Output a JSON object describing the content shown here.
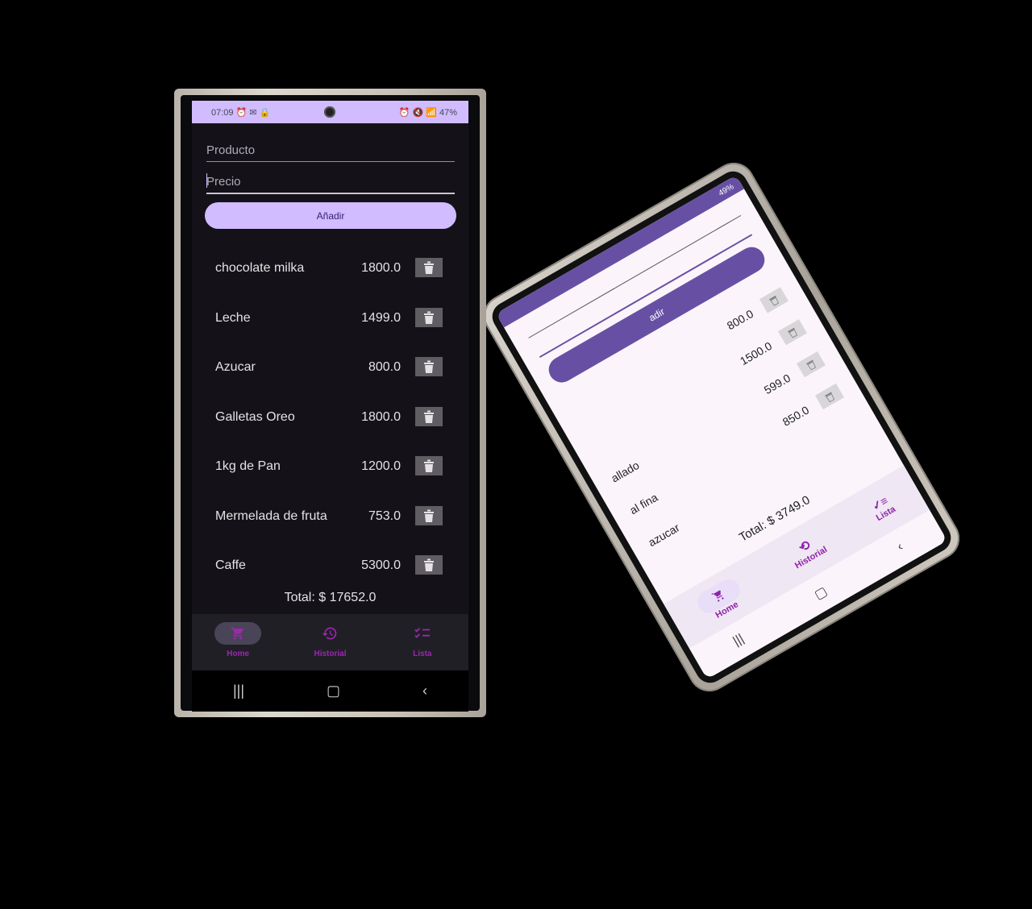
{
  "front_phone": {
    "status": {
      "time": "07:09",
      "battery": "47%"
    },
    "form": {
      "product_placeholder": "Producto",
      "price_placeholder": "Precio",
      "add_label": "Añadir"
    },
    "items": [
      {
        "name": "chocolate milka",
        "price": "1800.0"
      },
      {
        "name": "Leche",
        "price": "1499.0"
      },
      {
        "name": "Azucar",
        "price": "800.0"
      },
      {
        "name": "Galletas Oreo",
        "price": "1800.0"
      },
      {
        "name": "1kg de Pan",
        "price": "1200.0"
      },
      {
        "name": "Mermelada de fruta",
        "price": "753.0"
      },
      {
        "name": "Caffe",
        "price": "5300.0"
      }
    ],
    "total": "Total: $ 17652.0",
    "nav": {
      "home": "Home",
      "history": "Historial",
      "list": "Lista"
    },
    "icons": {
      "home": "cart-icon",
      "history": "history-icon",
      "list": "checklist-icon",
      "delete": "trash-icon"
    },
    "colors": {
      "accent": "#d0bcff",
      "nav_label": "#9c27b0",
      "background": "#141218"
    }
  },
  "back_phone": {
    "status": {
      "battery": "49%"
    },
    "add_label": "adir",
    "items": [
      {
        "name": "",
        "price": "800.0"
      },
      {
        "name": "",
        "price": "1500.0"
      },
      {
        "name": "allado",
        "price": "599.0"
      },
      {
        "name": "al fina",
        "price": "850.0"
      },
      {
        "name": "azucar",
        "price": ""
      }
    ],
    "total": "Total: $ 3749.0",
    "nav": {
      "home": "Home",
      "history": "Historial",
      "list": "Lista"
    },
    "colors": {
      "accent": "#6750a4",
      "background": "#fbf5fb"
    }
  }
}
